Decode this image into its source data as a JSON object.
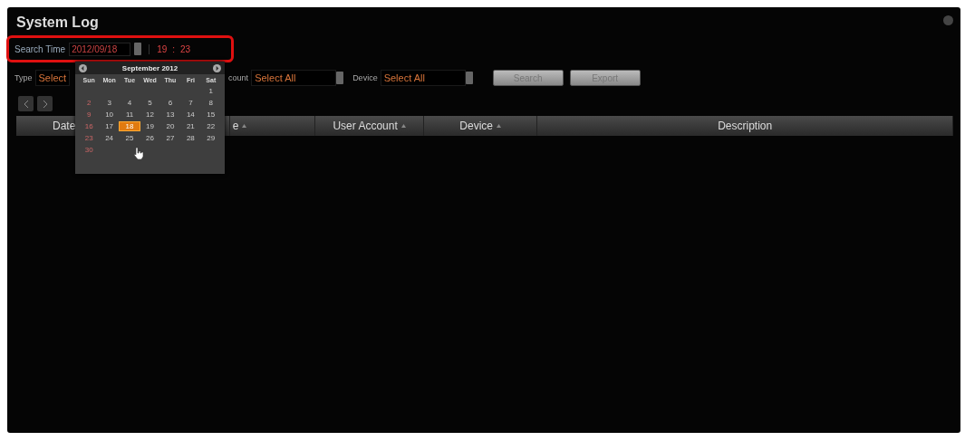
{
  "window": {
    "title": "System Log"
  },
  "search_time": {
    "label": "Search Time",
    "date": "2012/09/18",
    "hour": "19",
    "separator": ":",
    "minute": "23",
    "highlighted": true
  },
  "filters": [
    {
      "label": "Type",
      "value": "Select"
    },
    {
      "label": "count",
      "value": "Select All"
    },
    {
      "label": "Device",
      "value": "Select All"
    }
  ],
  "buttons": [
    "Search",
    "Export"
  ],
  "table": {
    "columns": [
      {
        "label": "Date",
        "sort": false
      },
      {
        "label": "e",
        "sort": true
      },
      {
        "label": "User Account",
        "sort": true
      },
      {
        "label": "Device",
        "sort": true
      },
      {
        "label": "Description",
        "sort": false
      }
    ]
  },
  "calendar": {
    "title": "September 2012",
    "weekdays": [
      "Sun",
      "Mon",
      "Tue",
      "Wed",
      "Thu",
      "Fri",
      "Sat"
    ],
    "weeks": [
      {
        "days": [
          {
            "day": "1",
            "selected": false
          }
        ]
      },
      {
        "days": [
          {
            "day": "2",
            "selected": false
          },
          {
            "day": "3",
            "selected": false
          },
          {
            "day": "4",
            "selected": false
          },
          {
            "day": "5",
            "selected": false
          },
          {
            "day": "6",
            "selected": false
          },
          {
            "day": "7",
            "selected": false
          },
          {
            "day": "8",
            "selected": false
          }
        ]
      },
      {
        "days": [
          {
            "day": "9",
            "selected": false
          },
          {
            "day": "10",
            "selected": false
          },
          {
            "day": "11",
            "selected": false
          },
          {
            "day": "12",
            "selected": false
          },
          {
            "day": "13",
            "selected": false
          },
          {
            "day": "14",
            "selected": false
          },
          {
            "day": "15",
            "selected": false
          }
        ]
      },
      {
        "days": [
          {
            "day": "16",
            "selected": false
          },
          {
            "day": "17",
            "selected": false
          },
          {
            "day": "18",
            "selected": true
          },
          {
            "day": "19",
            "selected": false
          },
          {
            "day": "20",
            "selected": false
          },
          {
            "day": "21",
            "selected": false
          },
          {
            "day": "22",
            "selected": false
          }
        ]
      },
      {
        "days": [
          {
            "day": "23",
            "selected": false
          },
          {
            "day": "24",
            "selected": false
          },
          {
            "day": "25",
            "selected": false
          },
          {
            "day": "26",
            "selected": false
          },
          {
            "day": "27",
            "selected": false
          },
          {
            "day": "28",
            "selected": false
          },
          {
            "day": "29",
            "selected": false
          }
        ]
      },
      {
        "days": [
          {
            "day": "30",
            "selected": false
          }
        ]
      }
    ]
  }
}
